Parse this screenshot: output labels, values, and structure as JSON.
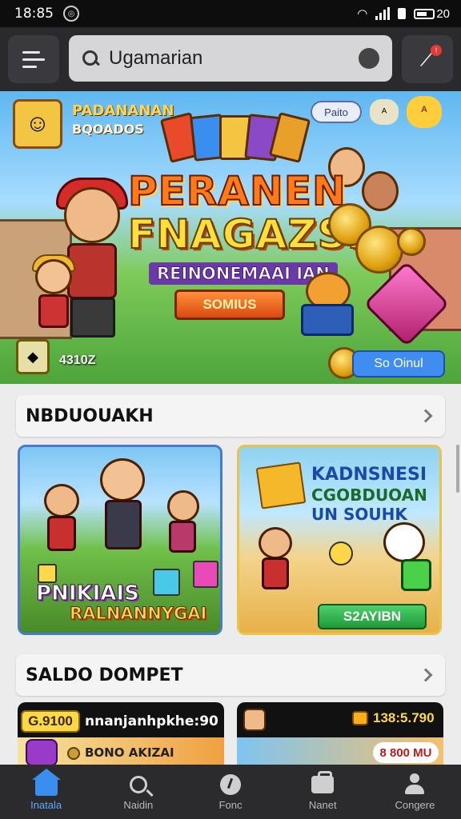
{
  "status_bar": {
    "time": "18:85",
    "battery_text": "20"
  },
  "search": {
    "value": "Ugamarian"
  },
  "hero": {
    "brand_line1": "PADANANAN",
    "brand_line2": "BQOADOS",
    "pill_label": "Paito",
    "icon1_label": "ᴬ",
    "icon2_label": "ᴬ",
    "title_line1": "PERANEN",
    "title_line2": "FNAGAZSI",
    "title_line3": "REINONEMAAI IAN",
    "bonus_label": "SOMIUS",
    "item_count": "4310Z",
    "cta_label": "So Oinul"
  },
  "sections": [
    {
      "label": "NBDUOUAKH"
    },
    {
      "label": "SALDO DOMPET"
    }
  ],
  "games": [
    {
      "title_line1": "PNIKIAIS",
      "title_line2": "RALNANNYGAI"
    },
    {
      "title_line1": "KADNSNESI",
      "title_line2": "CGOBDUOAN",
      "title_line3": "UN SOUHK",
      "button_label": "S2AYIBN"
    }
  ],
  "wallet": [
    {
      "amount": "G.9100",
      "text1": "nnanjanhpkhe:90",
      "text2": "BONO AKIZAI"
    },
    {
      "amount": "138:5.790",
      "pill": "8 800 MU"
    }
  ],
  "bottom_nav": [
    {
      "label": "Inatala",
      "icon": "home-icon",
      "active": true
    },
    {
      "label": "Naidin",
      "icon": "search-icon",
      "active": false
    },
    {
      "label": "Fonc",
      "icon": "clock-icon",
      "active": false
    },
    {
      "label": "Nanet",
      "icon": "bag-icon",
      "active": false
    },
    {
      "label": "Congere",
      "icon": "user-icon",
      "active": false
    }
  ],
  "colors": {
    "accent": "#5aa9ff",
    "appbar": "#2a2a2d",
    "nav": "#2b2b2e"
  }
}
